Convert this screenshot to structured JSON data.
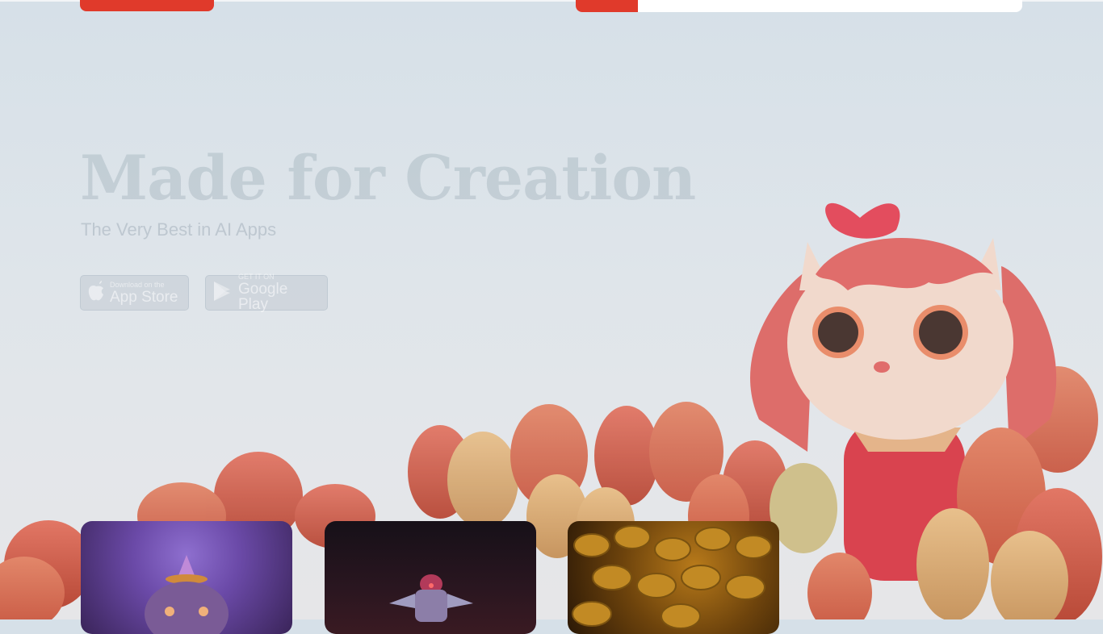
{
  "hero": {
    "title": "Made for Creation",
    "subtitle": "The Very Best in AI Apps"
  },
  "top_progress": {
    "fraction": 0.14,
    "accent": "#e03a2b"
  },
  "stores": {
    "apple_small": "Download on the",
    "apple_big": "App Store",
    "google_small": "GET IT ON",
    "google_big": "Google Play"
  },
  "icons": {
    "apple": "apple-icon",
    "google_play": "google-play-icon"
  },
  "colors": {
    "accent": "#e03a2b",
    "background": "#dfe5ea"
  }
}
